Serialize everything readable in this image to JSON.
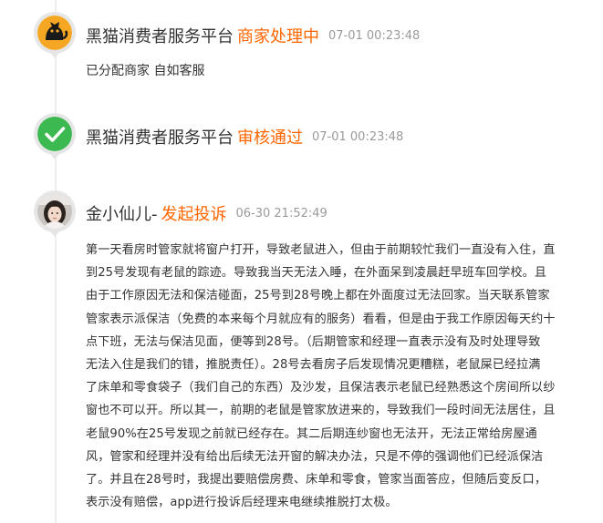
{
  "timeline": [
    {
      "name": "黑猫消费者服务平台",
      "status": "商家处理中",
      "time": "07-01 00:23:48",
      "text": "已分配商家 自如客服",
      "avatar_icon": "black-cat-logo-icon"
    },
    {
      "name": "黑猫消费者服务平台",
      "status": "审核通过",
      "time": "07-01 00:23:48",
      "avatar_icon": "check-circle-icon"
    },
    {
      "name": "金小仙儿-",
      "status": "发起投诉",
      "time": "06-30 21:52:49",
      "avatar_icon": "user-avatar",
      "complaint_lines": [
        "第一天看房时管家就将窗户打开，导致老鼠进入，但由于前期较忙我们一直没有入住，直",
        "到25号发现有老鼠的踪迹。导致我当天无法入睡，在外面呆到凌晨赶早班车回学校。且",
        "由于工作原因无法和保洁碰面，25号到28号晚上都在外面度过无法回家。当天联系管家",
        "管家表示派保洁（免费的本来每个月就应有的服务）看看，但是由于我工作原因每天约十",
        "点下班，无法与保洁见面，便等到28号。（后期管家和经理一直表示没有及时处理导致",
        "无法入住是我们的错，推脱责任）。28号去看房子后发现情况更糟糕，老鼠屎已经拉满",
        "了床单和零食袋子（我们自己的东西）及沙发，且保洁表示老鼠已经熟悉这个房间所以纱",
        "窗也不可以开。所以其一，前期的老鼠是管家放进来的，导致我们一段时间无法居住，且",
        "老鼠90%在25号发现之前就已经存在。其二后期连纱窗也无法开，无法正常给房屋通",
        "风，管家和经理并没有给出后续无法开窗的解决办法，只是不停的强调他们已经派保洁",
        "了。并且在28号时，我提出要赔偿房费、床单和零食，管家当面答应，但随后变反口，",
        "表示没有赔偿，app进行投诉后经理来电继续推脱打太极。"
      ]
    }
  ],
  "colors": {
    "status": "#ff6600",
    "check_green": "#3cb950",
    "logo_orange": "#f5a623"
  }
}
